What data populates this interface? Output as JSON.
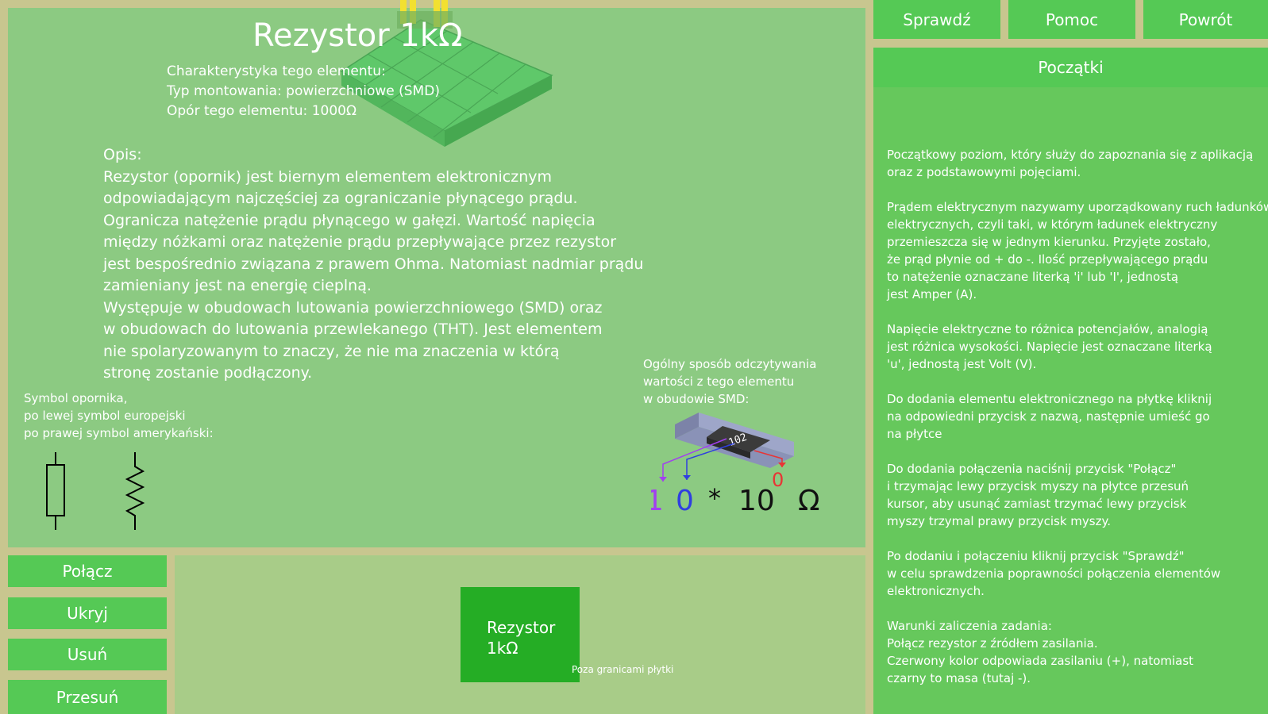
{
  "top_buttons": {
    "check": "Sprawdź",
    "help": "Pomoc",
    "back": "Powrót"
  },
  "info": {
    "title": "Rezystor 1kΩ",
    "characteristics": [
      "Charakterystyka tego elementu:",
      "Typ montowania: powierzchniowe (SMD)",
      "Opór tego elementu: 1000Ω"
    ],
    "description_heading": "Opis:",
    "description_lines": [
      "Rezystor (opornik) jest biernym elementem elektronicznym",
      "odpowiadającym najczęściej za ograniczanie płynącego prądu.",
      "Ogranicza natężenie prądu płynącego w gałęzi. Wartość napięcia",
      "między nóżkami oraz natężenie prądu przepływające przez rezystor",
      "jest bespośrednio związana z prawem Ohma. Natomiast nadmiar prądu",
      "zamieniany jest na energię cieplną.",
      "Występuje w obudowach lutowania powierzchniowego (SMD) oraz",
      "w obudowach do lutowania przewlekanego (THT). Jest elementem",
      "nie spolaryzowanym to znaczy, że nie ma znaczenia w którą",
      "stronę zostanie podłączony."
    ],
    "symbol_caption": [
      "Symbol opornika,",
      "po lewej symbol europejski",
      "po prawej symbol amerykański:"
    ],
    "smd_caption": [
      "Ogólny sposób odczytywania",
      "wartości z tego elementu",
      "w obudowie SMD:"
    ],
    "smd_code": "102",
    "formula": {
      "digit1": "1",
      "digit2": "0",
      "star": "*",
      "base": "10",
      "exponent": "0",
      "unit": "Ω"
    },
    "colors": {
      "digit1": "#a23ff0",
      "digit2": "#2f3fe0",
      "exponent": "#e83535"
    }
  },
  "tools": {
    "connect": "Połącz",
    "hide": "Ukryj",
    "delete": "Usuń",
    "move": "Przesuń"
  },
  "workspace": {
    "component_line1": "Rezystor",
    "component_line2": "1kΩ",
    "outside_label": "Poza granicami płytki"
  },
  "level": {
    "title": "Początki",
    "paragraphs": [
      [
        "Początkowy poziom, który służy do zapoznania się z aplikacją",
        "oraz z podstawowymi pojęciami."
      ],
      [
        "Prądem elektrycznym nazywamy uporządkowany ruch ładunków",
        "elektrycznych, czyli taki, w którym ładunek elektryczny",
        "przemieszcza się w jednym kierunku. Przyjęte zostało,",
        "że prąd płynie od + do -. Ilość przepływającego prądu",
        "to natężenie oznaczane literką 'i' lub 'I', jednostą",
        "jest Amper (A)."
      ],
      [
        "Napięcie elektryczne to różnica potencjałów, analogią",
        "jest różnica wysokości. Napięcie jest oznaczane literką",
        "'u', jednostą jest Volt (V)."
      ],
      [
        "Do dodania elementu elektronicznego na płytkę kliknij",
        "na odpowiedni przycisk z nazwą, następnie umieść go",
        "na płytce"
      ],
      [
        "Do dodania połączenia naciśnij przycisk \"Połącz\"",
        "i trzymając lewy przycisk myszy na płytce przesuń",
        "kursor, aby usunąć zamiast trzymać lewy przycisk",
        "myszy trzymal prawy przycisk myszy."
      ],
      [
        "Po dodaniu i połączeniu kliknij przycisk \"Sprawdź\"",
        "w celu sprawdzenia poprawności połączenia elementów",
        "elektronicznych."
      ],
      [
        "Warunki zaliczenia zadania:",
        "Połącz rezystor z źródłem zasilania.",
        "Czerwony kolor odpowiada zasilaniu (+), natomiast",
        "czarny to masa (tutaj -)."
      ]
    ]
  }
}
